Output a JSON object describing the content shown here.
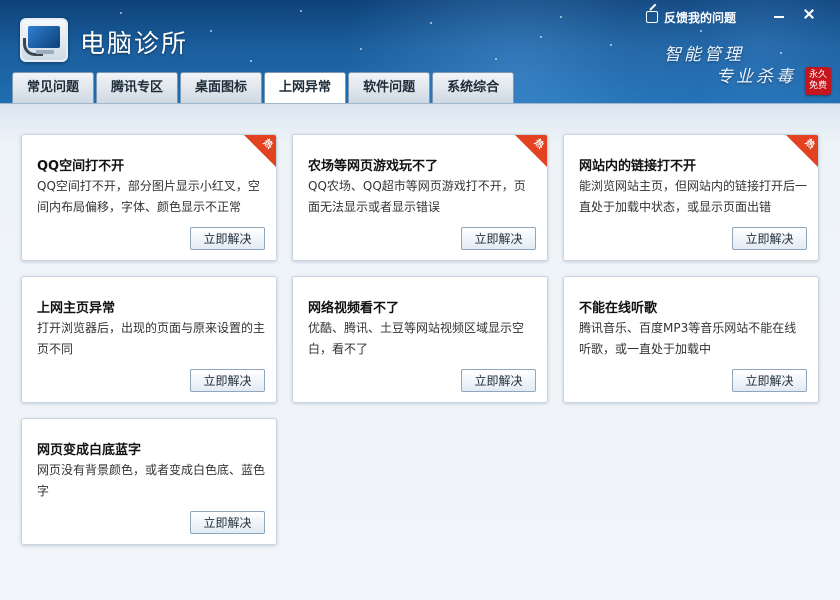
{
  "app": {
    "title": "电脑诊所",
    "feedback_label": "反馈我的问题",
    "slogan_line1": "智能管理",
    "slogan_line2": "专业杀毒",
    "free_seal": "永久免费"
  },
  "tabs": [
    {
      "label": "常见问题",
      "active": false
    },
    {
      "label": "腾讯专区",
      "active": false
    },
    {
      "label": "桌面图标",
      "active": false
    },
    {
      "label": "上网异常",
      "active": true
    },
    {
      "label": "软件问题",
      "active": false
    },
    {
      "label": "系统综合",
      "active": false
    }
  ],
  "cards": [
    {
      "title": "QQ空间打不开",
      "desc": "QQ空间打不开，部分图片显示小红叉，空间内布局偏移，字体、颜色显示不正常",
      "hot": true,
      "hot_label": "热",
      "button": "立即解决"
    },
    {
      "title": "农场等网页游戏玩不了",
      "desc": "QQ农场、QQ超市等网页游戏打不开，页面无法显示或者显示错误",
      "hot": true,
      "hot_label": "热",
      "button": "立即解决"
    },
    {
      "title": "网站内的链接打不开",
      "desc": "能浏览网站主页，但网站内的链接打开后一直处于加载中状态，或显示页面出错",
      "hot": true,
      "hot_label": "热",
      "button": "立即解决"
    },
    {
      "title": "上网主页异常",
      "desc": "打开浏览器后，出现的页面与原来设置的主页不同",
      "hot": false,
      "button": "立即解决"
    },
    {
      "title": "网络视频看不了",
      "desc": "优酷、腾讯、土豆等网站视频区域显示空白，看不了",
      "hot": false,
      "button": "立即解决"
    },
    {
      "title": "不能在线听歌",
      "desc": "腾讯音乐、百度MP3等音乐网站不能在线听歌，或一直处于加载中",
      "hot": false,
      "button": "立即解决"
    },
    {
      "title": "网页变成白底蓝字",
      "desc": "网页没有背景颜色，或者变成白色底、蓝色字",
      "hot": false,
      "button": "立即解决"
    }
  ],
  "colors": {
    "header_dark": "#0e4278",
    "hot_badge": "#e2421f",
    "seal_red": "#c4161c"
  }
}
